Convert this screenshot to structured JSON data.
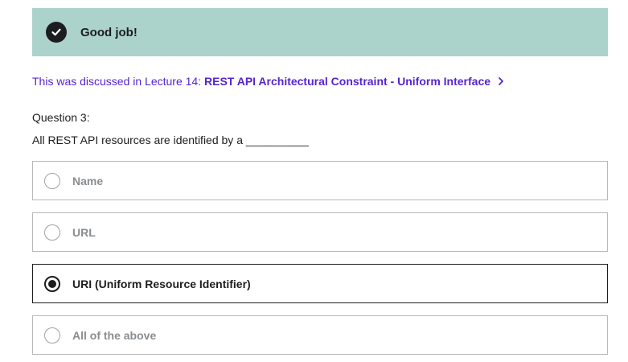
{
  "banner": {
    "icon": "check-circle-icon",
    "text": "Good job!",
    "color": "#acd2cc"
  },
  "lecture_reference": {
    "prefix": "This was discussed in Lecture 14: ",
    "link_text": "REST API Architectural Constraint - Uniform Interface",
    "link_icon": "chevron-right-icon",
    "color": "#5624d0"
  },
  "question": {
    "number_label": "Question 3:",
    "text": "All REST API resources are identified by a __________"
  },
  "options": [
    {
      "label": "Name",
      "selected": false
    },
    {
      "label": "URL",
      "selected": false
    },
    {
      "label": "URI (Uniform Resource Identifier)",
      "selected": true
    },
    {
      "label": "All of the above",
      "selected": false
    }
  ]
}
